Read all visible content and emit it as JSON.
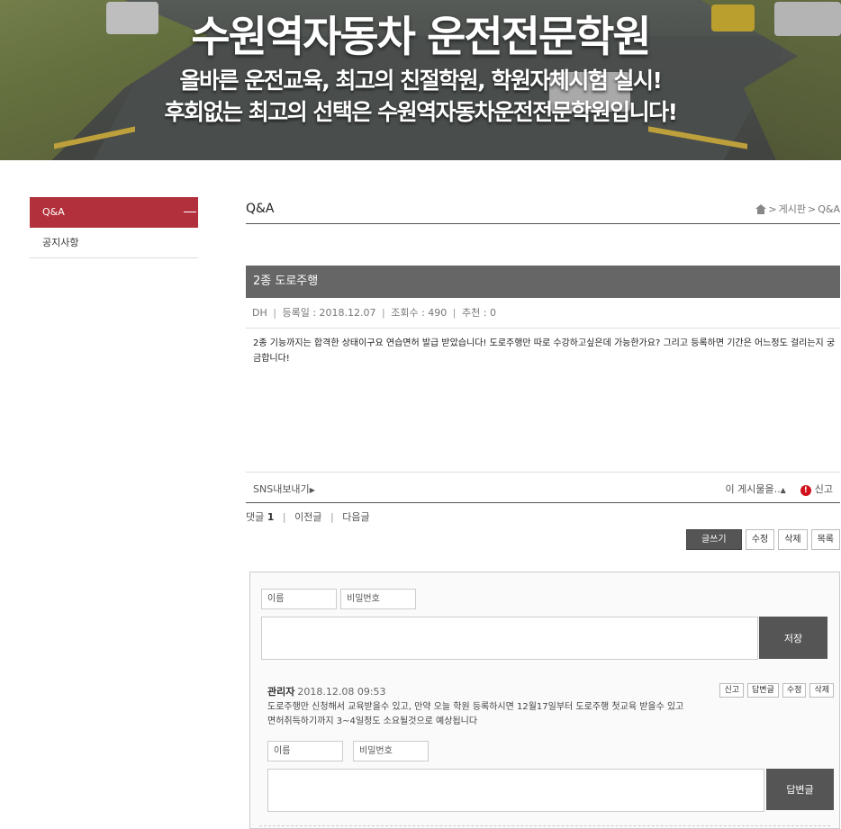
{
  "banner": {
    "title": "수원역자동차 운전전문학원",
    "subtitle_line1": "올바른 운전교육, 최고의 친절학원, 학원자체시험 실시!",
    "subtitle_line2": "후회없는 최고의 선택은 수원역자동차운전전문학원입니다!"
  },
  "sidebar": {
    "items": [
      {
        "label": "Q&A",
        "active": true
      },
      {
        "label": "공지사항",
        "active": false
      }
    ]
  },
  "page": {
    "title": "Q&A",
    "breadcrumb": [
      "게시판",
      "Q&A"
    ]
  },
  "post": {
    "title": "2종 도로주행",
    "author": "DH",
    "date_label": "등록일 : 2018.12.07",
    "views_label": "조회수 : 490",
    "recommend_label": "추천 : 0",
    "body": "2종 기능까지는 합격한 상태이구요 연습면허 발급 받았습니다! 도로주행만 따로 수강하고싶은데 가능한가요? 그리고 등록하면 기간은 어느정도 걸리는지 궁금합니다!"
  },
  "sns": {
    "share_label": "SNS내보내기",
    "post_menu_label": "이 게시물을..",
    "report_label": "신고"
  },
  "nav": {
    "comments_label": "댓글",
    "comments_count": "1",
    "prev_label": "이전글",
    "next_label": "다음글"
  },
  "buttons": {
    "write": "글쓰기",
    "edit": "수정",
    "delete": "삭제",
    "list": "목록"
  },
  "comment_form": {
    "name_placeholder": "이름",
    "password_placeholder": "비밀번호",
    "save_label": "저장"
  },
  "comment": {
    "author": "관리자",
    "date": "2018.12.08 09:53",
    "text_line1": "도로주행만 신청해서 교육받을수 있고, 만약 오늘 학원 등록하시면 12월17일부터 도로주행 첫교육 받을수 있고",
    "text_line2": "면허취득하기까지 3~4일정도 소요될것으로 예상됩니다",
    "actions": {
      "report": "신고",
      "reply": "답변글",
      "edit": "수정",
      "delete": "삭제"
    }
  },
  "reply_form": {
    "name_placeholder": "이름",
    "password_placeholder": "비밀번호",
    "submit_label": "답변글"
  },
  "colors": {
    "accent": "#b2303b",
    "title_bar": "#666666",
    "button_dark": "#555555",
    "report_icon": "#d0111b"
  }
}
